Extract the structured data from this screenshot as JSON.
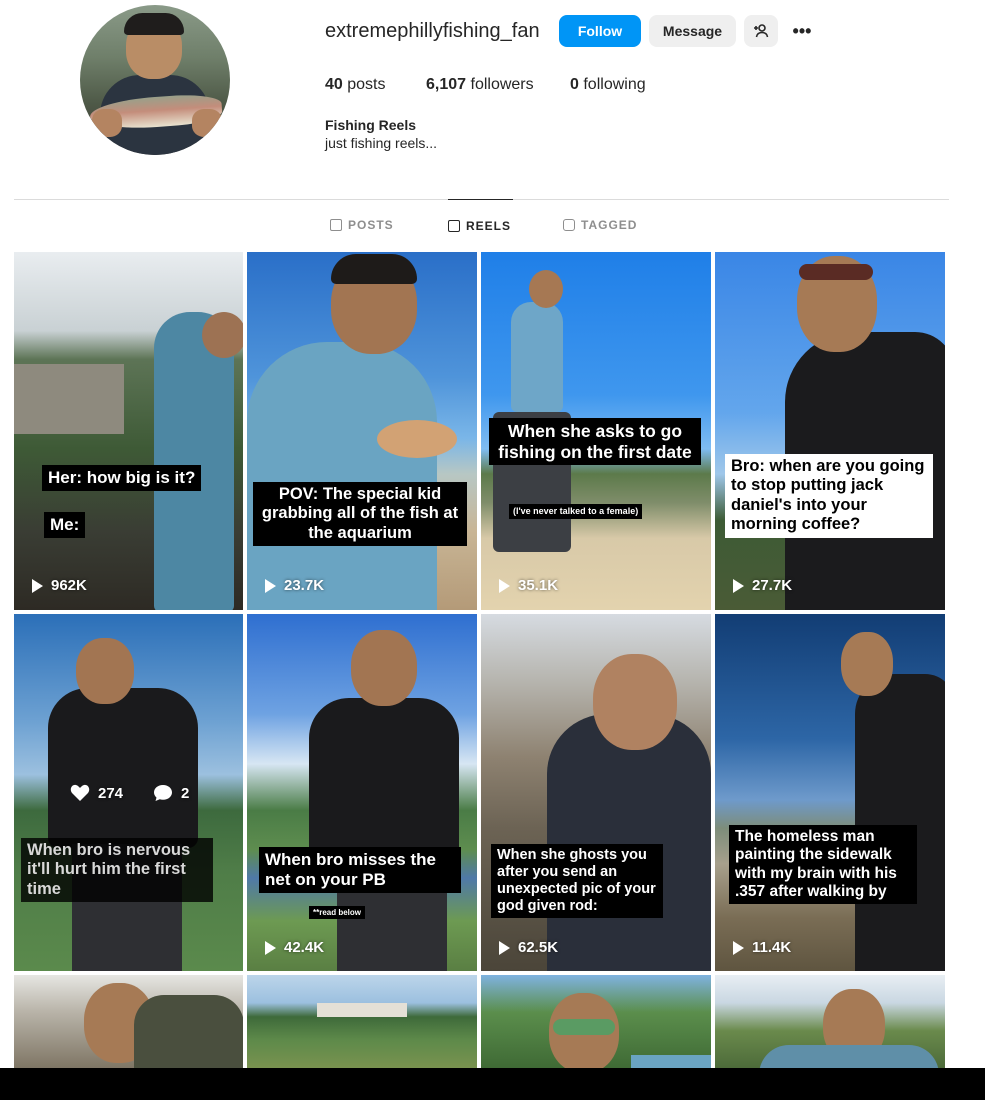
{
  "profile": {
    "username": "extremephillyfishing_fan",
    "follow_label": "Follow",
    "message_label": "Message",
    "more_glyph": "•••",
    "add_user_icon": "person-add-icon",
    "stats": {
      "posts_count": "40",
      "posts_label": "posts",
      "followers_count": "6,107",
      "followers_label": "followers",
      "following_count": "0",
      "following_label": "following"
    },
    "bio_name": "Fishing Reels",
    "bio_text": "just fishing reels..."
  },
  "tabs": [
    {
      "label": "POSTS",
      "icon": "grid-icon",
      "active": false
    },
    {
      "label": "REELS",
      "icon": "reels-icon",
      "active": true
    },
    {
      "label": "TAGGED",
      "icon": "tagged-icon",
      "active": false
    }
  ],
  "colors": {
    "follow_blue": "#0095f6",
    "button_gray": "#efefef",
    "text": "#262626",
    "muted": "#8e8e8e"
  },
  "reels": [
    {
      "captions": [
        "Her: how big is it?",
        "Me:"
      ],
      "views": "962K"
    },
    {
      "captions": [
        "POV: The special kid grabbing all of the fish at the aquarium"
      ],
      "views": "23.7K"
    },
    {
      "captions": [
        "When she asks to go fishing on the first date",
        "(I've never talked to a female)"
      ],
      "views": "35.1K"
    },
    {
      "captions": [
        "Bro: when are you going to stop putting jack daniel's into your morning coffee?"
      ],
      "views": "27.7K"
    },
    {
      "captions": [
        "When bro is nervous it'll hurt him the first time"
      ],
      "likes": "274",
      "comments": "2"
    },
    {
      "captions": [
        "When bro misses the net on your PB",
        "**read below"
      ],
      "views": "42.4K"
    },
    {
      "captions": [
        "When she ghosts you after you send an unexpected pic of your god given rod:"
      ],
      "views": "62.5K"
    },
    {
      "captions": [
        "The homeless man painting the sidewalk with my brain with his .357 after walking by"
      ],
      "views": "11.4K"
    },
    {
      "captions": []
    },
    {
      "captions": []
    },
    {
      "captions": []
    },
    {
      "captions": []
    }
  ]
}
